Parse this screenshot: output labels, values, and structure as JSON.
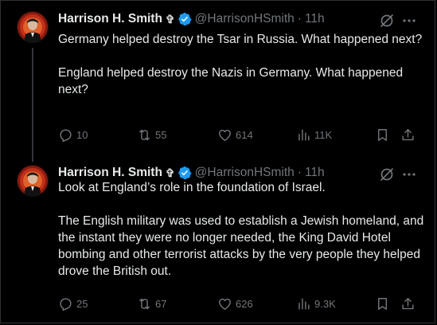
{
  "tweets": [
    {
      "author": {
        "name": "Harrison H. Smith",
        "badge_glyph": "✞",
        "handle": "@HarrisonHSmith",
        "time": "11h"
      },
      "paragraphs": [
        "Germany helped destroy the Tsar in Russia. What happened next?",
        "England helped destroy the Nazis in Germany. What happened next?"
      ],
      "stats": {
        "replies": "10",
        "reposts": "55",
        "likes": "614",
        "views": "11K"
      }
    },
    {
      "author": {
        "name": "Harrison H. Smith",
        "badge_glyph": "✞",
        "handle": "@HarrisonHSmith",
        "time": "11h"
      },
      "paragraphs": [
        "Look at England’s role in the foundation of Israel.",
        "The English military was used to establish a Jewish homeland, and the instant they were no longer needed, the King David Hotel bombing and other terrorist attacks by the very people they helped drove the British out."
      ],
      "stats": {
        "replies": "25",
        "reposts": "67",
        "likes": "626",
        "views": "9.3K"
      }
    }
  ],
  "separator": "·",
  "colors": {
    "background": "#000000",
    "text": "#e7e9ea",
    "muted": "#71767b",
    "verified": "#1d9bf0",
    "thread_line": "#333639"
  },
  "icons": [
    "verified-badge-icon",
    "grok-icon",
    "more-icon",
    "reply-icon",
    "repost-icon",
    "like-icon",
    "views-icon",
    "bookmark-icon",
    "share-icon"
  ]
}
